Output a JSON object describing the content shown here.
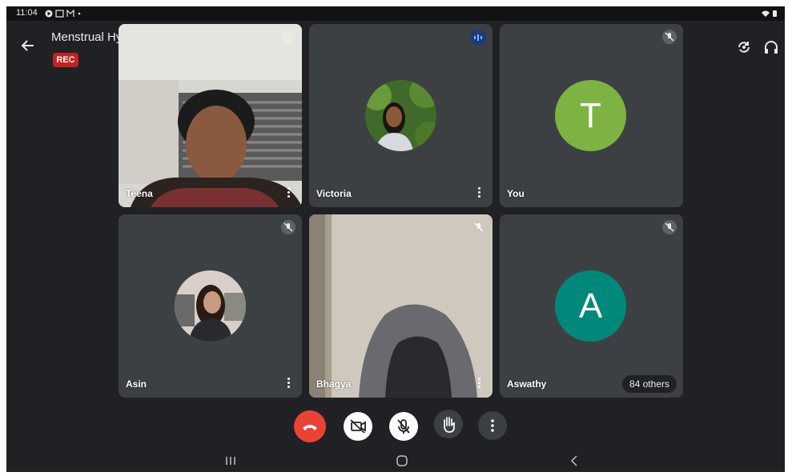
{
  "status_bar": {
    "time": "11:04",
    "icons": [
      "play-icon",
      "gallery-icon",
      "gmail-icon",
      "dot-icon"
    ],
    "right_icons": [
      "wifi-icon",
      "battery-icon"
    ]
  },
  "header": {
    "title": "Menstrual Hygiene",
    "rec_label": "REC"
  },
  "top_actions": [
    "switch-camera-icon",
    "audio-output-icon"
  ],
  "participants": [
    {
      "name": "Teena",
      "type": "video",
      "muted": true
    },
    {
      "name": "Victoria",
      "type": "photo",
      "speaking": true
    },
    {
      "name": "You",
      "type": "letter",
      "letter": "T",
      "color": "#7cb342",
      "muted": true
    },
    {
      "name": "Asin",
      "type": "photo",
      "muted": true
    },
    {
      "name": "Bhagya",
      "type": "video",
      "muted": true
    },
    {
      "name": "Aswathy",
      "type": "letter",
      "letter": "A",
      "color": "#00897b",
      "muted": true,
      "extra": "84 others"
    }
  ],
  "controls": [
    "end-call-icon",
    "camera-off-icon",
    "mic-off-icon",
    "raise-hand-icon",
    "more-options-icon"
  ],
  "colors": {
    "background": "#202124",
    "tile": "#3c4043",
    "end_call": "#ea4335",
    "rec": "#c5221f"
  }
}
